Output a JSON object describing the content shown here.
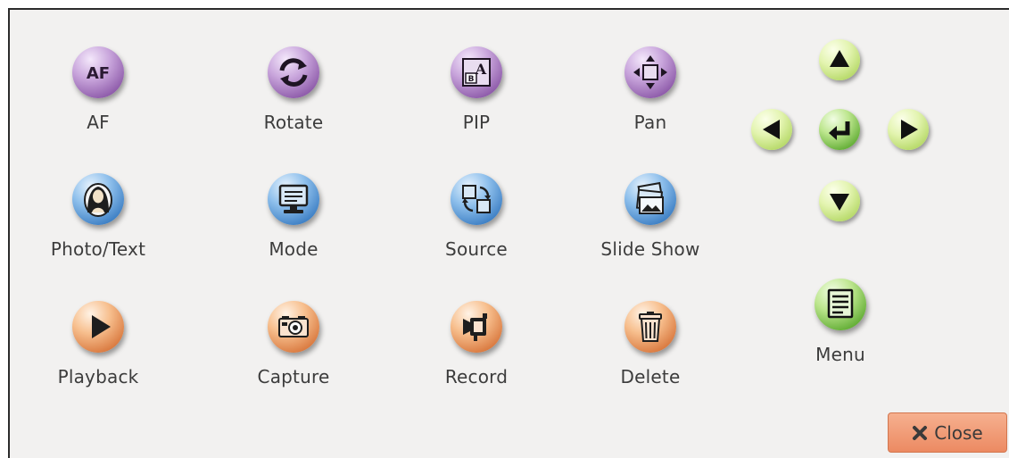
{
  "buttons": {
    "af": "AF",
    "rotate": "Rotate",
    "pip": "PIP",
    "pan": "Pan",
    "photo_text": "Photo/Text",
    "mode": "Mode",
    "source": "Source",
    "slide_show": "Slide Show",
    "playback": "Playback",
    "capture": "Capture",
    "record": "Record",
    "delete": "Delete",
    "menu": "Menu"
  },
  "af_icon_text": "AF",
  "close_label": "Close",
  "icons": {
    "af": "af-icon",
    "rotate": "rotate-arrows-icon",
    "pip": "picture-in-picture-icon",
    "pan": "pan-move-icon",
    "photo_text": "mona-lisa-icon",
    "mode": "monitor-icon",
    "source": "source-switch-icon",
    "slide_show": "photo-stack-icon",
    "playback": "play-icon",
    "capture": "camera-icon",
    "record": "video-camera-icon",
    "delete": "trash-icon",
    "menu": "menu-list-icon",
    "nav": [
      "arrow-up-icon",
      "arrow-left-icon",
      "enter-icon",
      "arrow-right-icon",
      "arrow-down-icon"
    ],
    "close": "close-x-icon"
  },
  "colors": {
    "purple": "#8d5aa9",
    "blue": "#3d7fc4",
    "orange": "#d9793f",
    "green": "#62ad35",
    "nav_lime": "#b6d968",
    "close_button": "#ec8a62",
    "panel_bg": "#f2f1f0"
  }
}
